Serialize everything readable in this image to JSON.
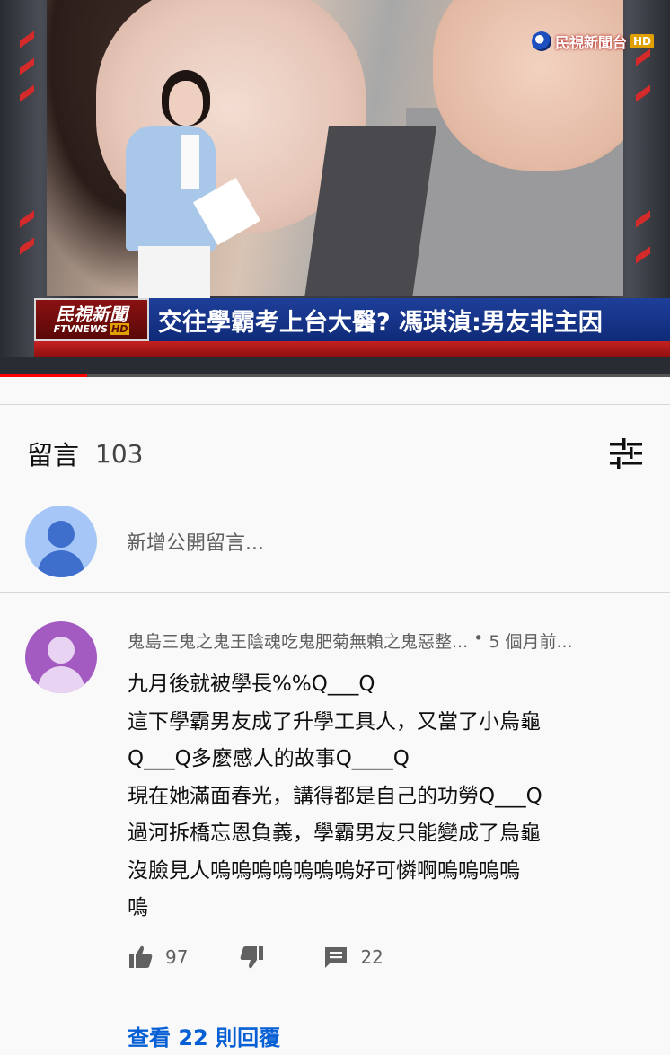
{
  "video": {
    "channel_logo": "民視新聞台",
    "channel_logo_hd": "HD",
    "lower_third": {
      "brand_cn": "民視新聞",
      "brand_en": "FTVNEWS",
      "brand_hd": "HD",
      "headline": "交往學霸考上台大醫? 馮琪湞:男友非主因"
    },
    "progress_fraction": 0.13
  },
  "comments_section": {
    "title": "留言",
    "count": "103",
    "sort_icon": "sort-filter-icon",
    "add_comment_placeholder": "新增公開留言..."
  },
  "comment": {
    "author": "鬼島三鬼之鬼王陰魂吃鬼肥菊無賴之鬼惡整...",
    "separator": "•",
    "time": "5 個月前...",
    "lines": [
      "九月後就被學長%%Q___Q",
      "這下學霸男友成了升學工具人，又當了小烏龜",
      "Q___Q多麼感人的故事Q____Q",
      "現在她滿面春光，講得都是自己的功勞Q___Q",
      "過河拆橋忘恩負義，學霸男友只能變成了烏龜",
      "沒臉見人嗚嗚嗚嗚嗚嗚嗚好可憐啊嗚嗚嗚嗚",
      "嗚"
    ],
    "likes": "97",
    "replies_count": "22",
    "view_replies": "查看 22 則回覆"
  },
  "colors": {
    "link": "#065fd4",
    "secondary_text": "#606060",
    "progress": "#ff0000"
  }
}
